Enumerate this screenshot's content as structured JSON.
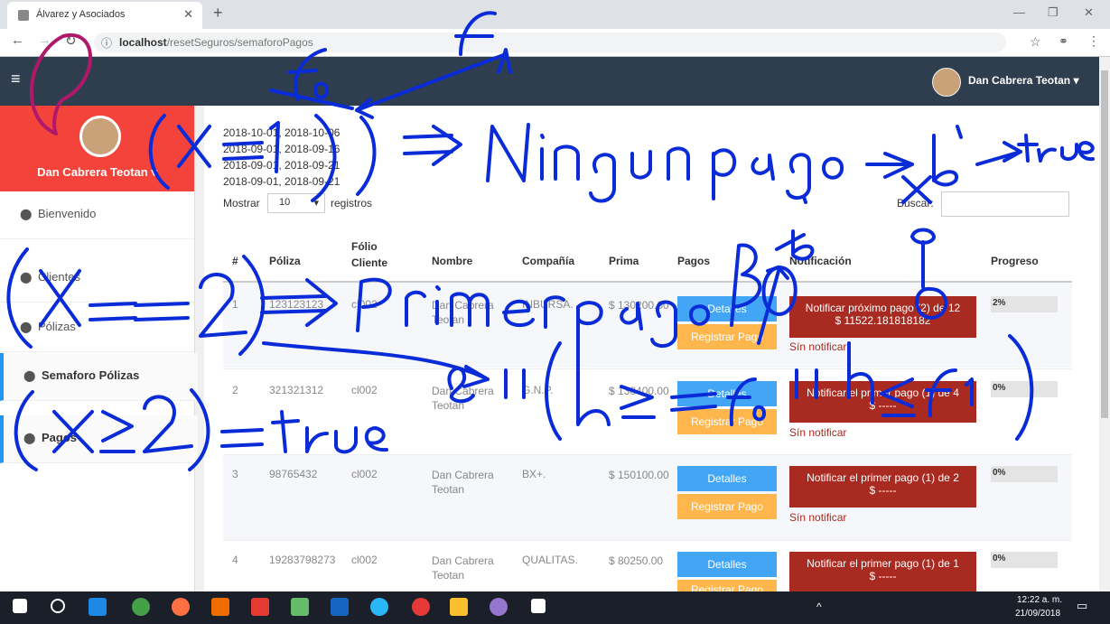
{
  "browser": {
    "tab_title": "Álvarez y Asociados",
    "url_host": "localhost",
    "url_path": "/resetSeguros/semaforoPagos"
  },
  "header": {
    "user_name": "Dan Cabrera Teotan ▾"
  },
  "sidebar": {
    "profile_name": "Dan Cabrera Teotan ▾",
    "items": [
      {
        "label": "Bienvenido"
      },
      {
        "label": "Clientes"
      },
      {
        "label": "Pólizas"
      },
      {
        "label": "Semaforo Pólizas"
      },
      {
        "label": "Pagos"
      }
    ]
  },
  "dates": [
    "2018-10-01, 2018-10-06",
    "2018-09-01, 2018-09-16",
    "2018-09-01, 2018-09-21",
    "2018-09-01, 2018-09-21"
  ],
  "controls": {
    "show_label": "Mostrar",
    "page_length": "10",
    "records_label": "registros",
    "search_label": "Buscar:"
  },
  "table": {
    "columns": [
      "#",
      "Póliza",
      "Fólio Cliente",
      "Nombre",
      "Compañía",
      "Prima",
      "Pagos",
      "Notificación",
      "Progreso"
    ],
    "rows": [
      {
        "num": "1",
        "poliza": "123123123",
        "folio": "cl002",
        "nombre": "Dan Cabrera Teotan",
        "compania": "INBURSA.",
        "prima": "$ 130200.00",
        "detalles": "Detalles",
        "registrar": "Registrar Pago",
        "notif_line1": "Notificar próximo pago (2) de 12",
        "notif_line2": "$ 11522.181818182",
        "sin": "Sín notificar",
        "progreso": "2%"
      },
      {
        "num": "2",
        "poliza": "321321312",
        "folio": "cl002",
        "nombre": "Dan Cabrera Teotan",
        "compania": "G.N.P.",
        "prima": "$ 130400.00",
        "detalles": "Detalles",
        "registrar": "Registrar Pago",
        "notif_line1": "Notificar el primer pago (1) de 4",
        "notif_line2": "$ -----",
        "sin": "Sín notificar",
        "progreso": "0%"
      },
      {
        "num": "3",
        "poliza": "98765432",
        "folio": "cl002",
        "nombre": "Dan Cabrera Teotan",
        "compania": "BX+.",
        "prima": "$ 150100.00",
        "detalles": "Detalles",
        "registrar": "Registrar Pago",
        "notif_line1": "Notificar el primer pago (1) de 2",
        "notif_line2": "$ -----",
        "sin": "Sín notificar",
        "progreso": "0%"
      },
      {
        "num": "4",
        "poliza": "19283798273",
        "folio": "cl002",
        "nombre": "Dan Cabrera Teotan",
        "compania": "QUALITAS.",
        "prima": "$ 80250.00",
        "detalles": "Detalles",
        "registrar": "Registrar Pago",
        "notif_line1": "Notificar el primer pago (1) de 1",
        "notif_line2": "$ -----",
        "sin": "",
        "progreso": "0%"
      }
    ]
  },
  "taskbar": {
    "time": "12:22 a. m.",
    "date": "21/09/2018"
  },
  "annotations": {
    "items": [
      "(x == 1) => Ningún pago -> b -> true",
      "(x == 2) => Primer pago B0",
      "(x >= 2) = true",
      "&& (h >= f0 && h <= f1)",
      "f0",
      "f1",
      "b",
      "x"
    ]
  }
}
